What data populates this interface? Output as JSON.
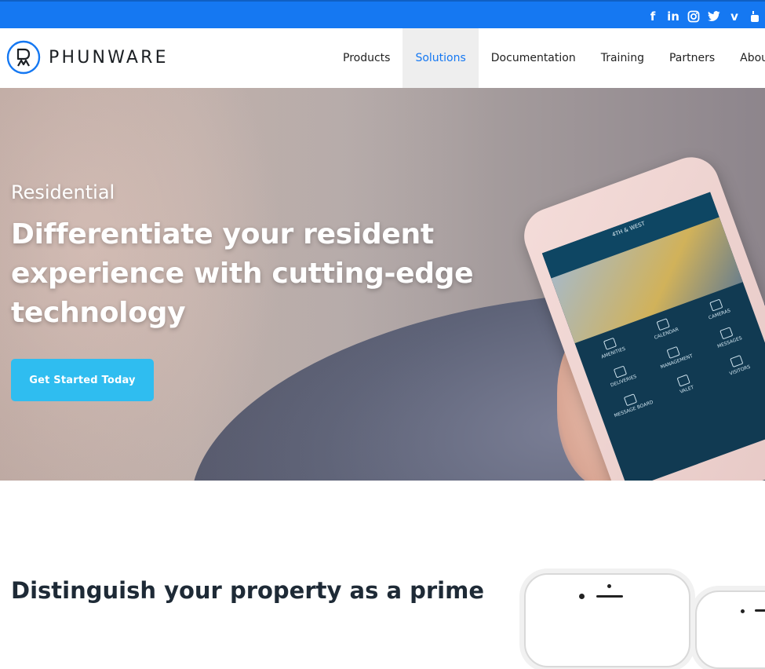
{
  "social": {
    "items": [
      {
        "name": "facebook",
        "glyph": "f"
      },
      {
        "name": "linkedin",
        "glyph": "in"
      },
      {
        "name": "instagram",
        "glyph": ""
      },
      {
        "name": "twitter",
        "glyph": ""
      },
      {
        "name": "vimeo",
        "glyph": "v"
      },
      {
        "name": "youtube",
        "glyph": ""
      }
    ]
  },
  "brand": {
    "name": "PHUNWARE",
    "accent": "#1578f2"
  },
  "nav": {
    "items": [
      {
        "label": "Products",
        "active": false
      },
      {
        "label": "Solutions",
        "active": true
      },
      {
        "label": "Documentation",
        "active": false
      },
      {
        "label": "Training",
        "active": false
      },
      {
        "label": "Partners",
        "active": false
      },
      {
        "label": "About",
        "active": false
      }
    ]
  },
  "hero": {
    "eyebrow": "Residential",
    "headline": "Differentiate your resident experience with cutting-edge technology",
    "cta_label": "Get Started Today",
    "cta_color": "#2fbdf0",
    "app_screen": {
      "title": "4TH & WEST",
      "tiles": [
        "AMENITIES",
        "CALENDAR",
        "CAMERAS",
        "DELIVERIES",
        "MANAGEMENT",
        "MESSAGES",
        "MESSAGE BOARD",
        "VALET",
        "VISITORS"
      ]
    }
  },
  "section": {
    "title": "Distinguish your property as a prime"
  }
}
